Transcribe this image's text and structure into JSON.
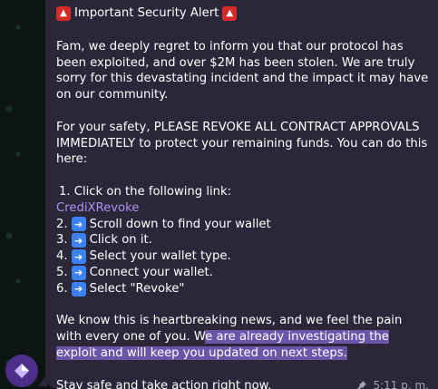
{
  "message": {
    "title": "Important Security Alert",
    "p1": "Fam, we deeply regret to inform you that our protocol has been exploited, and over $2M has been stolen. We are truly sorry for this devastating incident and the impact it may have on our community.",
    "p2": "For your safety, PLEASE REVOKE ALL CONTRACT APPROVALS IMMEDIATELY to protect your remaining funds. You can do this here:",
    "step1": "1. Click on the following link:",
    "link": "CrediXRevoke",
    "steps": [
      {
        "num": "2.",
        "text": "Scroll down to find your wallet"
      },
      {
        "num": "3.",
        "text": "Click on it."
      },
      {
        "num": "4.",
        "text": "Select your wallet type."
      },
      {
        "num": "5.",
        "text": "Connect your wallet."
      },
      {
        "num": "6.",
        "text": "Select \"Revoke\""
      }
    ],
    "p3_start": "We know this is heartbreaking news, and we feel the pain with every one of you. W",
    "p3_highlight": "e are already investigating the exploit and will keep you updated on next steps.",
    "closing": "Stay safe and take action right now.",
    "time": "5:11 p. m."
  },
  "icons": {
    "alarm": "rotating-light-icon",
    "arrow": "right-arrow-icon",
    "pin": "pin-icon"
  },
  "colors": {
    "bubble": "#2b2638",
    "link": "#a895f2",
    "highlight": "#6a56a8",
    "avatar": "#4c2f8a"
  }
}
